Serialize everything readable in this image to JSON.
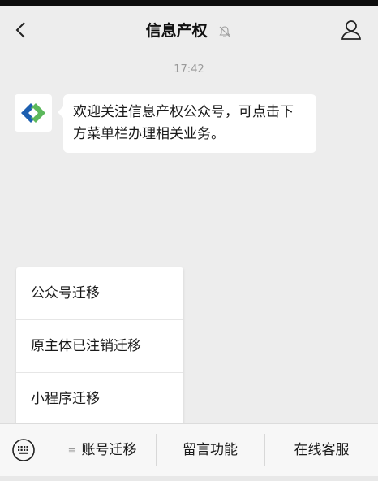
{
  "nav": {
    "title": "信息产权",
    "back_icon": "chevron-left-icon",
    "mute_icon": "bell-muted-icon",
    "profile_icon": "person-icon"
  },
  "chat": {
    "timestamp": "17:42",
    "message": "欢迎关注信息产权公众号，可点击下方菜单栏办理相关业务。"
  },
  "submenu": {
    "items": [
      "公众号迁移",
      "原主体已注销迁移",
      "小程序迁移"
    ]
  },
  "menu": {
    "keyboard_icon": "keyboard-icon",
    "items": [
      {
        "label": "账号迁移",
        "marker": "≡"
      },
      {
        "label": "留言功能"
      },
      {
        "label": "在线客服"
      }
    ]
  },
  "colors": {
    "background": "#ededed",
    "bubble": "#ffffff",
    "logo_blue": "#1d5fb0",
    "logo_green": "#5cb85c"
  }
}
